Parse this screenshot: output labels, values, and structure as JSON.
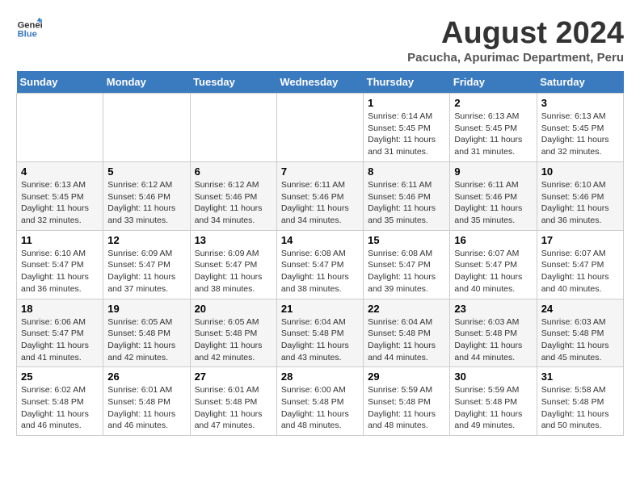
{
  "header": {
    "logo_general": "General",
    "logo_blue": "Blue",
    "title": "August 2024",
    "subtitle": "Pacucha, Apurimac Department, Peru"
  },
  "weekdays": [
    "Sunday",
    "Monday",
    "Tuesday",
    "Wednesday",
    "Thursday",
    "Friday",
    "Saturday"
  ],
  "weeks": [
    [
      {
        "day": "",
        "info": ""
      },
      {
        "day": "",
        "info": ""
      },
      {
        "day": "",
        "info": ""
      },
      {
        "day": "",
        "info": ""
      },
      {
        "day": "1",
        "info": "Sunrise: 6:14 AM\nSunset: 5:45 PM\nDaylight: 11 hours\nand 31 minutes."
      },
      {
        "day": "2",
        "info": "Sunrise: 6:13 AM\nSunset: 5:45 PM\nDaylight: 11 hours\nand 31 minutes."
      },
      {
        "day": "3",
        "info": "Sunrise: 6:13 AM\nSunset: 5:45 PM\nDaylight: 11 hours\nand 32 minutes."
      }
    ],
    [
      {
        "day": "4",
        "info": "Sunrise: 6:13 AM\nSunset: 5:45 PM\nDaylight: 11 hours\nand 32 minutes."
      },
      {
        "day": "5",
        "info": "Sunrise: 6:12 AM\nSunset: 5:46 PM\nDaylight: 11 hours\nand 33 minutes."
      },
      {
        "day": "6",
        "info": "Sunrise: 6:12 AM\nSunset: 5:46 PM\nDaylight: 11 hours\nand 34 minutes."
      },
      {
        "day": "7",
        "info": "Sunrise: 6:11 AM\nSunset: 5:46 PM\nDaylight: 11 hours\nand 34 minutes."
      },
      {
        "day": "8",
        "info": "Sunrise: 6:11 AM\nSunset: 5:46 PM\nDaylight: 11 hours\nand 35 minutes."
      },
      {
        "day": "9",
        "info": "Sunrise: 6:11 AM\nSunset: 5:46 PM\nDaylight: 11 hours\nand 35 minutes."
      },
      {
        "day": "10",
        "info": "Sunrise: 6:10 AM\nSunset: 5:46 PM\nDaylight: 11 hours\nand 36 minutes."
      }
    ],
    [
      {
        "day": "11",
        "info": "Sunrise: 6:10 AM\nSunset: 5:47 PM\nDaylight: 11 hours\nand 36 minutes."
      },
      {
        "day": "12",
        "info": "Sunrise: 6:09 AM\nSunset: 5:47 PM\nDaylight: 11 hours\nand 37 minutes."
      },
      {
        "day": "13",
        "info": "Sunrise: 6:09 AM\nSunset: 5:47 PM\nDaylight: 11 hours\nand 38 minutes."
      },
      {
        "day": "14",
        "info": "Sunrise: 6:08 AM\nSunset: 5:47 PM\nDaylight: 11 hours\nand 38 minutes."
      },
      {
        "day": "15",
        "info": "Sunrise: 6:08 AM\nSunset: 5:47 PM\nDaylight: 11 hours\nand 39 minutes."
      },
      {
        "day": "16",
        "info": "Sunrise: 6:07 AM\nSunset: 5:47 PM\nDaylight: 11 hours\nand 40 minutes."
      },
      {
        "day": "17",
        "info": "Sunrise: 6:07 AM\nSunset: 5:47 PM\nDaylight: 11 hours\nand 40 minutes."
      }
    ],
    [
      {
        "day": "18",
        "info": "Sunrise: 6:06 AM\nSunset: 5:47 PM\nDaylight: 11 hours\nand 41 minutes."
      },
      {
        "day": "19",
        "info": "Sunrise: 6:05 AM\nSunset: 5:48 PM\nDaylight: 11 hours\nand 42 minutes."
      },
      {
        "day": "20",
        "info": "Sunrise: 6:05 AM\nSunset: 5:48 PM\nDaylight: 11 hours\nand 42 minutes."
      },
      {
        "day": "21",
        "info": "Sunrise: 6:04 AM\nSunset: 5:48 PM\nDaylight: 11 hours\nand 43 minutes."
      },
      {
        "day": "22",
        "info": "Sunrise: 6:04 AM\nSunset: 5:48 PM\nDaylight: 11 hours\nand 44 minutes."
      },
      {
        "day": "23",
        "info": "Sunrise: 6:03 AM\nSunset: 5:48 PM\nDaylight: 11 hours\nand 44 minutes."
      },
      {
        "day": "24",
        "info": "Sunrise: 6:03 AM\nSunset: 5:48 PM\nDaylight: 11 hours\nand 45 minutes."
      }
    ],
    [
      {
        "day": "25",
        "info": "Sunrise: 6:02 AM\nSunset: 5:48 PM\nDaylight: 11 hours\nand 46 minutes."
      },
      {
        "day": "26",
        "info": "Sunrise: 6:01 AM\nSunset: 5:48 PM\nDaylight: 11 hours\nand 46 minutes."
      },
      {
        "day": "27",
        "info": "Sunrise: 6:01 AM\nSunset: 5:48 PM\nDaylight: 11 hours\nand 47 minutes."
      },
      {
        "day": "28",
        "info": "Sunrise: 6:00 AM\nSunset: 5:48 PM\nDaylight: 11 hours\nand 48 minutes."
      },
      {
        "day": "29",
        "info": "Sunrise: 5:59 AM\nSunset: 5:48 PM\nDaylight: 11 hours\nand 48 minutes."
      },
      {
        "day": "30",
        "info": "Sunrise: 5:59 AM\nSunset: 5:48 PM\nDaylight: 11 hours\nand 49 minutes."
      },
      {
        "day": "31",
        "info": "Sunrise: 5:58 AM\nSunset: 5:48 PM\nDaylight: 11 hours\nand 50 minutes."
      }
    ]
  ]
}
